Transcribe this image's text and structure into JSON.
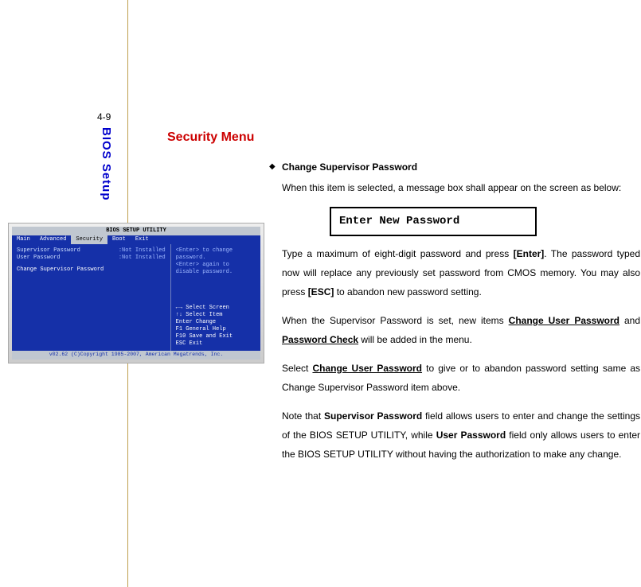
{
  "page_number": "4-9",
  "sidebar_label": "BIOS Setup",
  "heading": "Security Menu",
  "bullet_title": "Change Supervisor Password",
  "intro": "When this item is selected, a message box shall appear on the screen as below:",
  "password_box": "Enter New Password",
  "para1_a": "Type a maximum of eight-digit password and press ",
  "para1_enter": "[Enter]",
  "para1_b": ". The password typed now will replace any previously set password from CMOS memory. You may also press ",
  "para1_esc": "[ESC]",
  "para1_c": " to abandon new password setting.",
  "para2_a": "When the Supervisor Password is set, new items ",
  "para2_cup": "Change User Password",
  "para2_b": " and ",
  "para2_pc": "Password Check",
  "para2_c": " will be added in the menu.",
  "para3_a": "Select ",
  "para3_cup": "Change User Password",
  "para3_b": " to give or to abandon password setting same as Change Supervisor Password item above.",
  "para4_a": "Note that ",
  "para4_sp": "Supervisor Password",
  "para4_b": " field allows users to enter and change the settings of the BIOS SETUP UTILITY, while ",
  "para4_up": "User Password",
  "para4_c": " field only allows users to enter the BIOS SETUP UTILITY without having the authorization to make any change.",
  "bios": {
    "title": "BIOS SETUP UTILITY",
    "tabs": {
      "main": "Main",
      "advanced": "Advanced",
      "security": "Security",
      "boot": "Boot",
      "exit": "Exit"
    },
    "left": {
      "sup_label": "Supervisor Password",
      "sup_val": ":Not Installed",
      "usr_label": "User Password",
      "usr_val": ":Not Installed",
      "change": "Change Supervisor Password"
    },
    "right_top": "<Enter> to change password.\n<Enter> again to disable password.",
    "right_bot": "←→  Select Screen\n↑↓  Select Item\nEnter Change\nF1   General Help\nF10  Save and Exit\nESC  Exit",
    "footer": "v02.62 (C)Copyright 1985-2007, American Megatrends, Inc."
  }
}
